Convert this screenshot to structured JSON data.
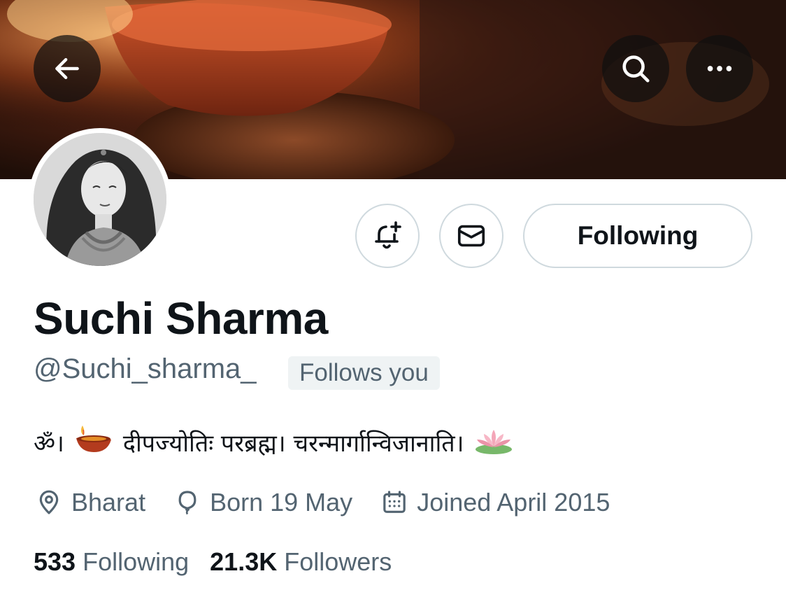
{
  "header": {
    "back_icon": "arrow-left-icon",
    "search_icon": "search-icon",
    "more_icon": "more-horizontal-icon"
  },
  "actions": {
    "notify_icon": "bell-plus-icon",
    "message_icon": "envelope-icon",
    "following_label": "Following"
  },
  "profile": {
    "name": "Suchi Sharma",
    "handle": "@Suchi_sharma_",
    "follows_you": "Follows you",
    "bio": {
      "part1": "ॐ।",
      "part2": "दीपज्योतिः परब्रह्म। चरन्मार्गान्विजानाति।",
      "emoji1": "diya-lamp-icon",
      "emoji2": "lotus-icon"
    },
    "location": "Bharat",
    "birthday": "Born 19 May",
    "joined": "Joined April 2015"
  },
  "stats": {
    "following_count": "533",
    "following_label": "Following",
    "followers_count": "21.3K",
    "followers_label": "Followers"
  },
  "colors": {
    "text_primary": "#0f1419",
    "text_secondary": "#536471",
    "border": "#cfd9de",
    "badge_bg": "#eff3f4"
  }
}
